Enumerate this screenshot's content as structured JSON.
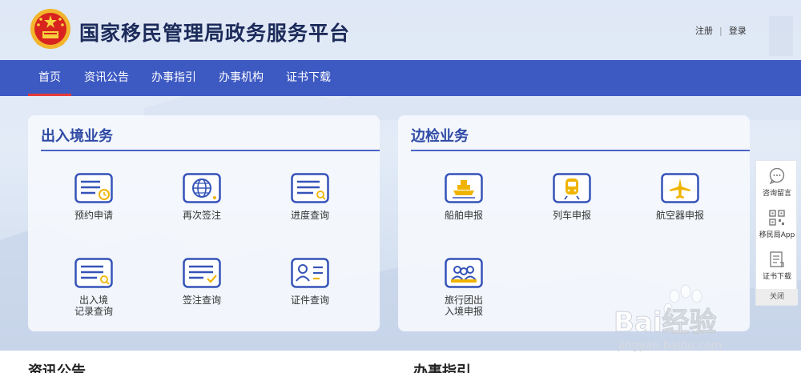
{
  "header": {
    "title": "国家移民管理局政务服务平台",
    "register": "注册",
    "separator": "|",
    "login": "登录"
  },
  "nav": {
    "items": [
      {
        "label": "首页",
        "active": true
      },
      {
        "label": "资讯公告"
      },
      {
        "label": "办事指引"
      },
      {
        "label": "办事机构"
      },
      {
        "label": "证书下载"
      }
    ]
  },
  "left_card": {
    "title": "出入境业务",
    "services": [
      {
        "label": "预约申请",
        "icon": "appointment-clock-icon"
      },
      {
        "label": "再次签注",
        "icon": "globe-document-icon"
      },
      {
        "label": "进度查询",
        "icon": "progress-search-icon"
      },
      {
        "label": "出入境\n记录查询",
        "icon": "record-search-icon"
      },
      {
        "label": "签注查询",
        "icon": "endorsement-check-icon"
      },
      {
        "label": "证件查询",
        "icon": "id-card-icon"
      }
    ]
  },
  "right_card": {
    "title": "边检业务",
    "services": [
      {
        "label": "船舶申报",
        "icon": "ship-icon"
      },
      {
        "label": "列车申报",
        "icon": "train-icon"
      },
      {
        "label": "航空器申报",
        "icon": "airplane-icon"
      },
      {
        "label": "旅行团出\n入境申报",
        "icon": "tour-group-icon"
      }
    ]
  },
  "float_bar": {
    "items": [
      {
        "label": "咨询留言",
        "icon": "chat-bubble-icon"
      },
      {
        "label": "移民局App",
        "icon": "qr-code-icon"
      },
      {
        "label": "证书下载",
        "icon": "certificate-download-icon"
      }
    ],
    "close": "关闭"
  },
  "bottom": {
    "news_title": "资讯公告",
    "guide_title": "办事指引"
  },
  "watermark": {
    "text": "Bai经验",
    "url": "jingyan.baidu.com"
  },
  "colors": {
    "nav_bg": "#3d59c2",
    "accent_blue": "#2f4aa5",
    "icon_gold": "#f0b400",
    "active_underline": "#e53a3a"
  }
}
